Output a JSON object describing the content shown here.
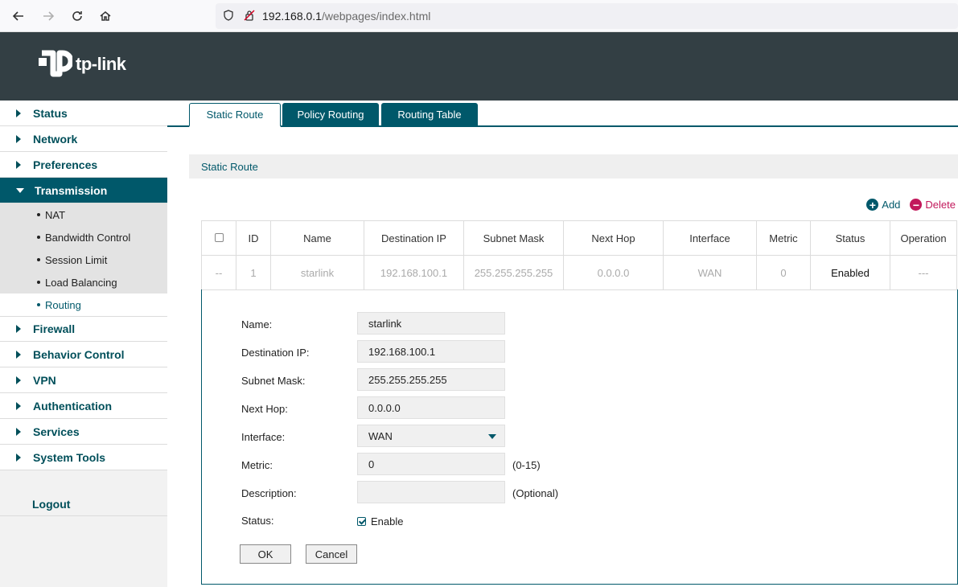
{
  "browser": {
    "url_host": "192.168.0.1",
    "url_path": "/webpages/index.html"
  },
  "header": {
    "logo_text": "tp-link"
  },
  "sidebar": {
    "items": [
      {
        "label": "Status"
      },
      {
        "label": "Network"
      },
      {
        "label": "Preferences"
      },
      {
        "label": "Transmission",
        "expanded": true,
        "sub": [
          {
            "label": "NAT"
          },
          {
            "label": "Bandwidth Control"
          },
          {
            "label": "Session Limit"
          },
          {
            "label": "Load Balancing"
          },
          {
            "label": "Routing",
            "current": true
          }
        ]
      },
      {
        "label": "Firewall"
      },
      {
        "label": "Behavior Control"
      },
      {
        "label": "VPN"
      },
      {
        "label": "Authentication"
      },
      {
        "label": "Services"
      },
      {
        "label": "System Tools"
      }
    ],
    "logout": "Logout"
  },
  "tabs": [
    {
      "label": "Static Route",
      "active": true
    },
    {
      "label": "Policy Routing"
    },
    {
      "label": "Routing Table"
    }
  ],
  "section_title": "Static Route",
  "actions": {
    "add": "Add",
    "delete": "Delete"
  },
  "table": {
    "headers": [
      "",
      "ID",
      "Name",
      "Destination IP",
      "Subnet Mask",
      "Next Hop",
      "Interface",
      "Metric",
      "Status",
      "Operation"
    ],
    "row": [
      "--",
      "1",
      "starlink",
      "192.168.100.1",
      "255.255.255.255",
      "0.0.0.0",
      "WAN",
      "0",
      "Enabled",
      "---"
    ]
  },
  "form": {
    "name_label": "Name:",
    "name_value": "starlink",
    "dest_label": "Destination IP:",
    "dest_value": "192.168.100.1",
    "mask_label": "Subnet Mask:",
    "mask_value": "255.255.255.255",
    "hop_label": "Next Hop:",
    "hop_value": "0.0.0.0",
    "iface_label": "Interface:",
    "iface_value": "WAN",
    "metric_label": "Metric:",
    "metric_value": "0",
    "metric_hint": "(0-15)",
    "desc_label": "Description:",
    "desc_value": "",
    "desc_hint": "(Optional)",
    "status_label": "Status:",
    "status_check": "Enable",
    "ok": "OK",
    "cancel": "Cancel"
  },
  "colors": {
    "accent": "#00586a",
    "header": "#333f44",
    "delete": "#c2185b"
  }
}
